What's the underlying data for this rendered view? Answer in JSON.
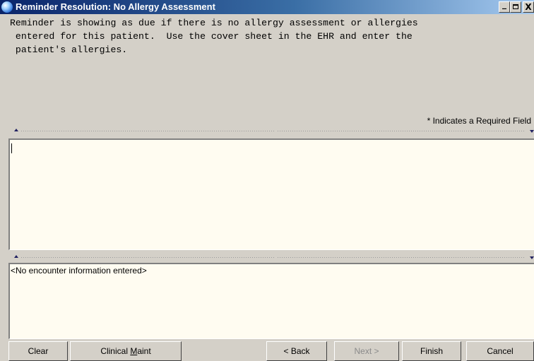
{
  "window": {
    "title": "Reminder Resolution: No Allergy Assessment",
    "controls": {
      "minimize_icon": "minimize-icon",
      "maximize_icon": "maximize-icon",
      "close_glyph": "X"
    }
  },
  "reminder": {
    "text": "Reminder is showing as due if there is no allergy assessment or allergies\n entered for this patient.  Use the cover sheet in the EHR and enter the\n patient's allergies."
  },
  "required_note": "* Indicates a Required Field",
  "dialog_editor": {
    "value": ""
  },
  "encounter_info": {
    "text": "<No encounter information entered>"
  },
  "buttons": {
    "clear": "Clear",
    "clinical_maint": {
      "before": "Clinical ",
      "underlined": "M",
      "after": "aint"
    },
    "back": "< Back",
    "next": {
      "label": "Next >",
      "disabled": true
    },
    "finish": "Finish",
    "cancel": "Cancel"
  },
  "colors": {
    "title_gradient_start": "#0a246a",
    "title_gradient_end": "#a6caf0",
    "pane_background": "#fffcf1",
    "window_background": "#d4d0c8"
  }
}
